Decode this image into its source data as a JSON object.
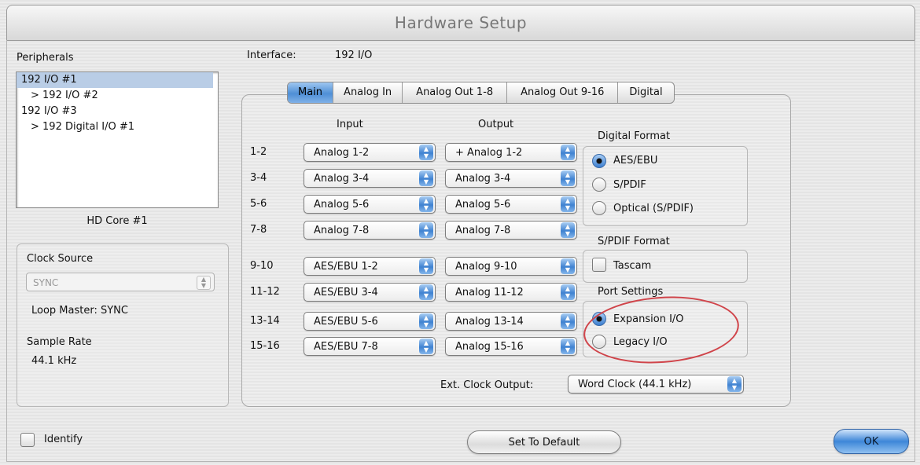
{
  "window": {
    "title": "Hardware Setup"
  },
  "left": {
    "peripherals_label": "Peripherals",
    "peripherals": [
      {
        "label": "192 I/O #1",
        "indent": false,
        "selected": true
      },
      {
        "label": "> 192 I/O #2",
        "indent": true,
        "selected": false
      },
      {
        "label": "192 I/O #3",
        "indent": false,
        "selected": false
      },
      {
        "label": "> 192 Digital I/O #1",
        "indent": true,
        "selected": false
      }
    ],
    "core_label": "HD Core #1",
    "clock_source_label": "Clock Source",
    "clock_source_value": "SYNC",
    "loop_master": "Loop Master: SYNC",
    "sample_rate_label": "Sample Rate",
    "sample_rate_value": "44.1 kHz"
  },
  "interface": {
    "label": "Interface:",
    "value": "192 I/O"
  },
  "tabs": [
    "Main",
    "Analog In",
    "Analog Out 1-8",
    "Analog Out 9-16",
    "Digital"
  ],
  "active_tab": "Main",
  "io": {
    "input_header": "Input",
    "output_header": "Output",
    "rows": [
      {
        "channels": "1-2",
        "input": "Analog 1-2",
        "output": "+ Analog 1-2"
      },
      {
        "channels": "3-4",
        "input": "Analog 3-4",
        "output": "Analog 3-4"
      },
      {
        "channels": "5-6",
        "input": "Analog 5-6",
        "output": "Analog 5-6"
      },
      {
        "channels": "7-8",
        "input": "Analog 7-8",
        "output": "Analog 7-8"
      },
      {
        "channels": "9-10",
        "input": "AES/EBU 1-2",
        "output": "Analog 9-10"
      },
      {
        "channels": "11-12",
        "input": "AES/EBU 3-4",
        "output": "Analog 11-12"
      },
      {
        "channels": "13-14",
        "input": "AES/EBU 5-6",
        "output": "Analog 13-14"
      },
      {
        "channels": "15-16",
        "input": "AES/EBU 7-8",
        "output": "Analog 15-16"
      }
    ]
  },
  "digital_format": {
    "label": "Digital Format",
    "options": [
      "AES/EBU",
      "S/PDIF",
      "Optical (S/PDIF)"
    ],
    "selected": "AES/EBU"
  },
  "spdif_format": {
    "label": "S/PDIF Format",
    "tascam_label": "Tascam",
    "tascam_checked": false
  },
  "port_settings": {
    "label": "Port Settings",
    "options": [
      "Expansion I/O",
      "Legacy I/O"
    ],
    "selected": "Expansion I/O",
    "annotation_color": "#d0444a"
  },
  "ext_clock": {
    "label": "Ext. Clock Output:",
    "value": "Word Clock (44.1 kHz)"
  },
  "footer": {
    "identify_label": "Identify",
    "default_label": "Set To Default",
    "ok_label": "OK"
  },
  "colors": {
    "accent": "#3f82d1",
    "selection": "#b9cde6"
  }
}
